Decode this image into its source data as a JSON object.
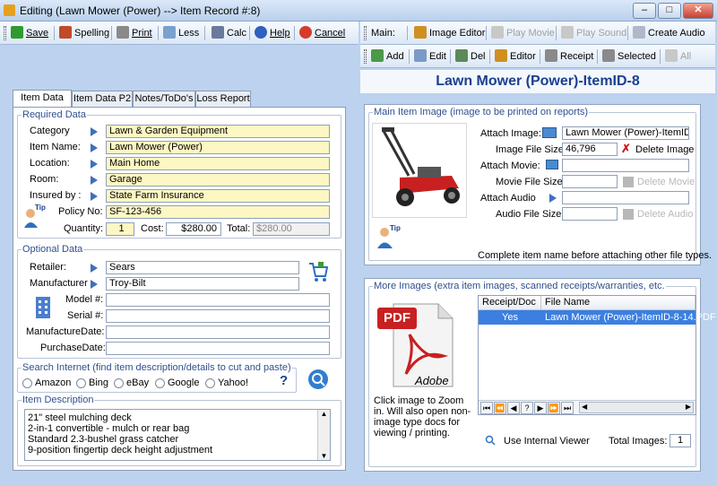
{
  "window": {
    "title": "Editing  (Lawn Mower (Power) --> Item Record #:8)",
    "min_label": "–",
    "max_label": "□",
    "close_label": "✕"
  },
  "toolbar_left": {
    "save": "Save",
    "spelling": "Spelling",
    "print": "Print",
    "less": "Less",
    "calc": "Calc",
    "help": "Help",
    "cancel": "Cancel"
  },
  "toolbar_main": {
    "label": "Main:",
    "image_editor": "Image Editor",
    "play_movie": "Play Movie",
    "play_sound": "Play Sound",
    "create_audio": "Create Audio"
  },
  "toolbar_images": {
    "add": "Add",
    "edit": "Edit",
    "del": "Del",
    "editor": "Editor",
    "receipt": "Receipt",
    "selected": "Selected",
    "all": "All"
  },
  "tabs": [
    "Item Data P1",
    "Item Data P2",
    "Notes/ToDo's",
    "Loss Report"
  ],
  "required": {
    "legend": "Required Data",
    "category_label": "Category",
    "category": "Lawn & Garden Equipment",
    "item_name_label": "Item Name:",
    "item_name": "Lawn Mower (Power)",
    "location_label": "Location:",
    "location": "Main Home",
    "room_label": "Room:",
    "room": "Garage",
    "insured_label": "Insured by :",
    "insured": "State Farm Insurance",
    "policy_label": "Policy No:",
    "policy": "SF-123-456",
    "tip_label": "Tip",
    "quantity_label": "Quantity:",
    "quantity": "1",
    "cost_label": "Cost:",
    "cost": "$280.00",
    "total_label": "Total:",
    "total": "$280.00"
  },
  "optional": {
    "legend": "Optional Data",
    "retailer_label": "Retailer:",
    "retailer": "Sears",
    "manufacturer_label": "Manufacturer",
    "manufacturer": "Troy-Bilt",
    "model_label": "Model #:",
    "model": "",
    "serial_label": "Serial #:",
    "serial": "",
    "mfg_date_label": "ManufactureDate:",
    "mfg_date": "",
    "purchase_date_label": "PurchaseDate:",
    "purchase_date": ""
  },
  "search": {
    "legend": "Search Internet (find item description/details to cut and paste)",
    "options": [
      "Amazon",
      "Bing",
      "eBay",
      "Google",
      "Yahoo!"
    ],
    "help": "?"
  },
  "description": {
    "legend": "Item Description",
    "lines": [
      "21\" steel mulching deck",
      "2-in-1 convertible - mulch or rear bag",
      "Standard 2.3-bushel grass catcher",
      "9-position fingertip deck height adjustment"
    ]
  },
  "heading": "Lawn Mower (Power)-ItemID-8",
  "main_image": {
    "legend": "Main Item Image (image to be printed on reports)",
    "attach_image_label": "Attach Image:",
    "attach_image": "Lawn Mower (Power)-ItemID-8.",
    "image_size_label": "Image File Size:",
    "image_size": "46,796",
    "delete_image": "Delete Image",
    "attach_movie_label": "Attach Movie:",
    "attach_movie": "",
    "movie_size_label": "Movie File Size:",
    "movie_size": "",
    "delete_movie": "Delete Movie",
    "attach_audio_label": "Attach Audio",
    "attach_audio": "",
    "audio_size_label": "Audio File Size:",
    "audio_size": "",
    "delete_audio": "Delete Audio",
    "tip_label": "Tip",
    "note": "Complete item name before attaching other file types."
  },
  "more_images": {
    "legend": "More Images (extra item images, scanned receipts/warranties, etc.",
    "pdf_label": "PDF",
    "adobe_label": "Adobe",
    "col_receipt": "Receipt/Doc",
    "col_file": "File Name",
    "rows": [
      {
        "receipt": "Yes",
        "file": "Lawn Mower (Power)-ItemID-8-14.PDF"
      }
    ],
    "zoom_text": "Click image to Zoom in. Will also open non-image type docs for viewing / printing.",
    "nav": [
      "⏮",
      "⏪",
      "◀",
      "?",
      "▶",
      "⏩",
      "⏭"
    ],
    "use_viewer": "Use Internal Viewer",
    "total_label": "Total Images:",
    "total": "1"
  },
  "colors": {
    "required_field": "#fdf7c3",
    "heading": "#1b3f8f",
    "selected_row": "#3b7fe0"
  }
}
